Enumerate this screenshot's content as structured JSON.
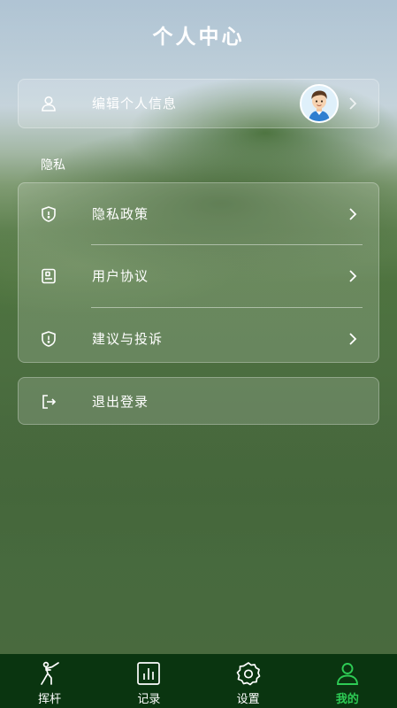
{
  "header": {
    "title": "个人中心"
  },
  "profile": {
    "edit_label": "编辑个人信息",
    "avatar_icon": "cartoon-avatar"
  },
  "privacy": {
    "section_title": "隐私",
    "items": [
      {
        "label": "隐私政策",
        "icon": "shield-icon"
      },
      {
        "label": "用户协议",
        "icon": "agreement-icon"
      },
      {
        "label": "建议与投诉",
        "icon": "shield-alert-icon"
      }
    ]
  },
  "logout": {
    "label": "退出登录",
    "icon": "logout-icon"
  },
  "tabbar": {
    "items": [
      {
        "label": "挥杆",
        "icon": "golfer-icon",
        "active": false
      },
      {
        "label": "记录",
        "icon": "chart-icon",
        "active": false
      },
      {
        "label": "设置",
        "icon": "settings-icon",
        "active": false
      },
      {
        "label": "我的",
        "icon": "user-icon",
        "active": true
      }
    ],
    "active_color": "#2ecc55",
    "background": "#0a3510"
  }
}
